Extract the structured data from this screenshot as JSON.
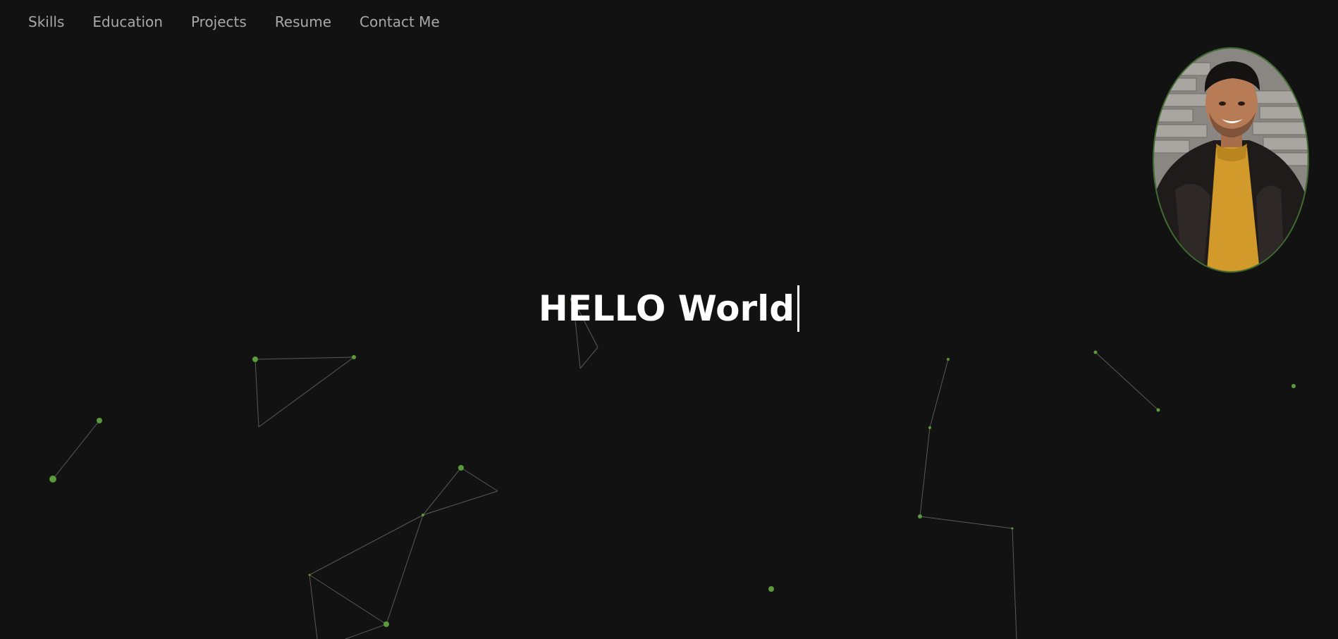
{
  "nav": {
    "items": [
      {
        "label": "Skills",
        "name": "nav-skills"
      },
      {
        "label": "Education",
        "name": "nav-education"
      },
      {
        "label": "Projects",
        "name": "nav-projects"
      },
      {
        "label": "Resume",
        "name": "nav-resume"
      },
      {
        "label": "Contact Me",
        "name": "nav-contact-me"
      }
    ]
  },
  "hero": {
    "title": "HELLO World"
  },
  "profile": {
    "photo": "profile-photo"
  },
  "colors": {
    "background": "#121212",
    "accent": "#5a9a3a",
    "text": "#ffffff",
    "nav_text": "#a8a8a8",
    "line": "#555555"
  }
}
